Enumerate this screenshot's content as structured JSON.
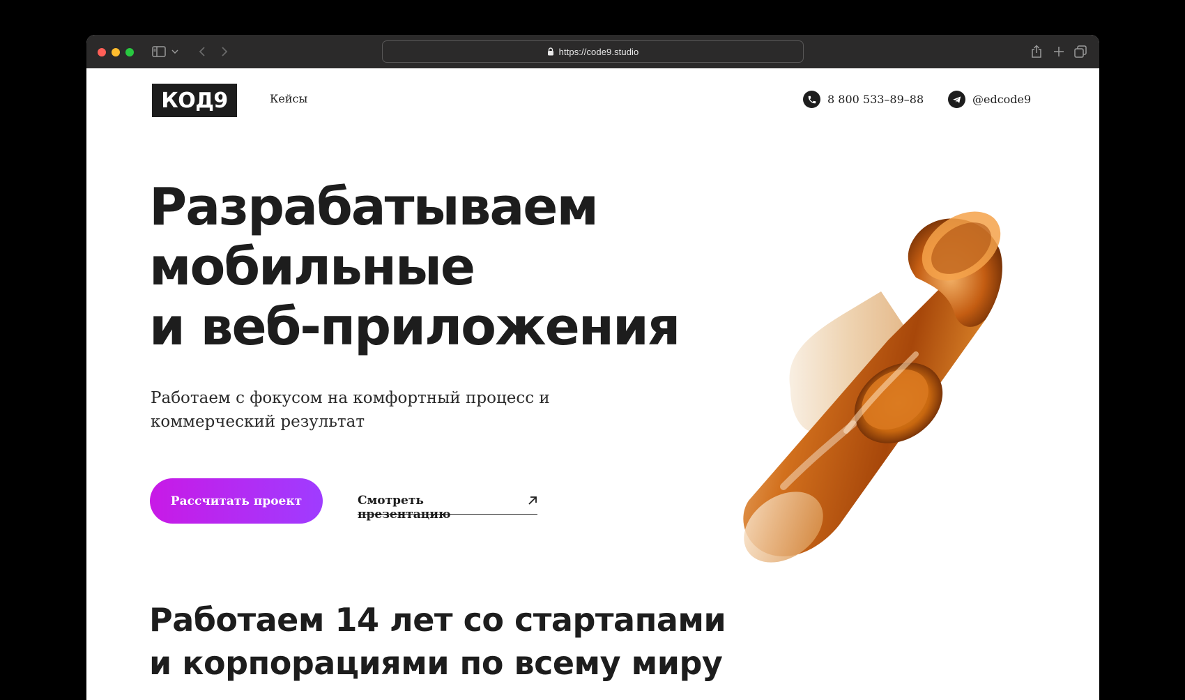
{
  "browser": {
    "url": "https://code9.studio"
  },
  "header": {
    "logo_text": "КОД9",
    "nav": {
      "cases_label": "Кейсы"
    },
    "phone": "8 800 533–89–88",
    "telegram": "@edcode9"
  },
  "hero": {
    "title_lines": [
      "Разрабатываем",
      "мобильные",
      "и веб-приложения"
    ],
    "subtitle": "Работаем с фокусом на комфортный процесс и коммерческий результат",
    "primary_cta": "Рассчитать проект",
    "secondary_cta": "Смотреть презентацию",
    "secondary_cta_icon": "arrow-up-right-icon"
  },
  "section": {
    "title_lines": [
      "Работаем 14 лет со стартапами",
      "и корпорациями по всему миру"
    ]
  },
  "colors": {
    "text": "#1d1d1d",
    "cta_gradient_start": "#c81ae6",
    "cta_gradient_end": "#9f3cff",
    "chrome": "#2b2a2a"
  }
}
